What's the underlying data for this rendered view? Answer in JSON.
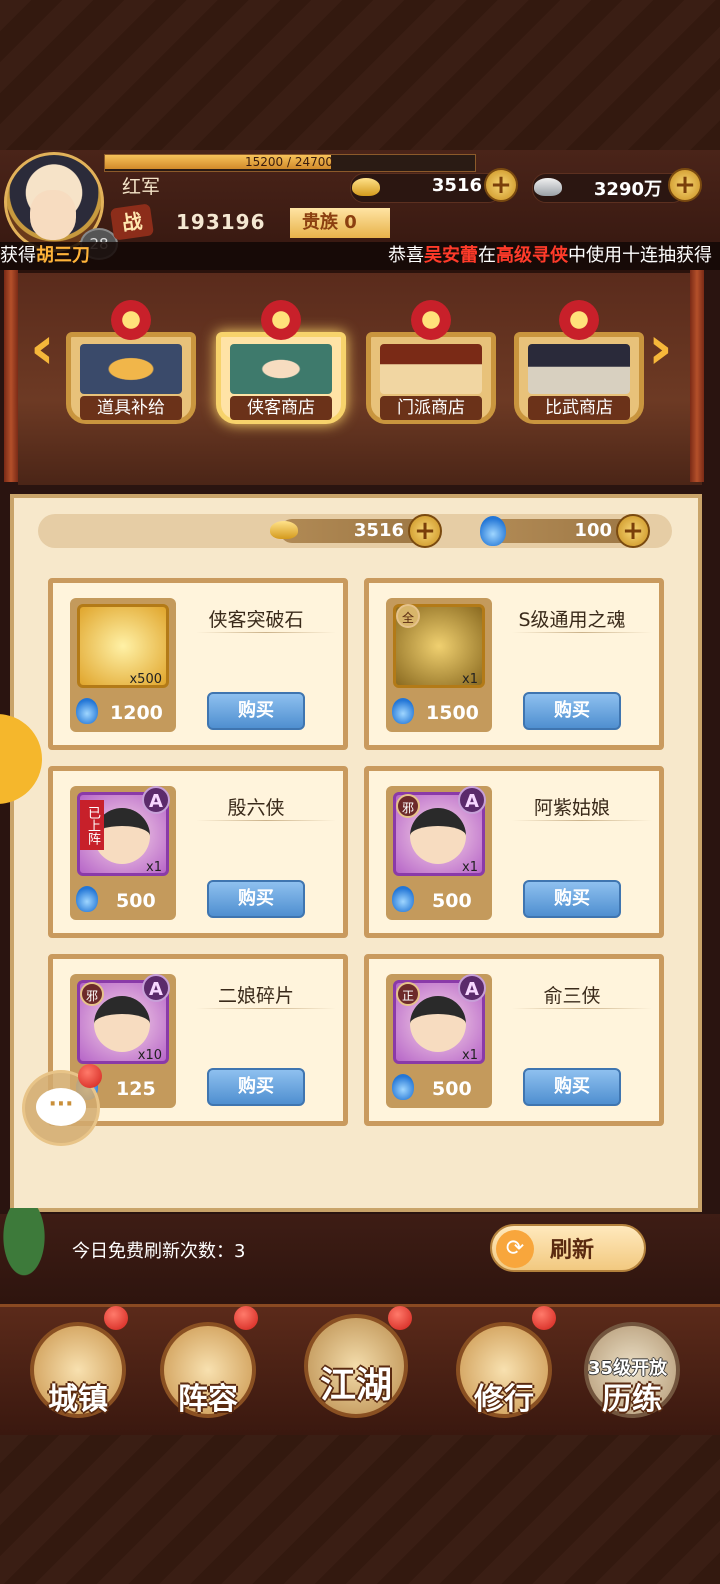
{
  "header": {
    "exp_text": "15200 / 24700",
    "exp_fraction": 0.615,
    "player_name": "红军",
    "level": "28",
    "gold": "3516",
    "silver": "3290万",
    "power_label": "战",
    "power_value": "193196",
    "noble_label": "贵族 0"
  },
  "marquee": {
    "left_prefix": "获得",
    "left_name": "胡三刀",
    "right_prefix": "恭喜",
    "right_name": "吴安蕾",
    "right_mid": "在",
    "right_event": "高级寻侠",
    "right_suffix": "中使用十连抽获得"
  },
  "tabs": [
    {
      "label": "道具补给",
      "active": false
    },
    {
      "label": "侠客商店",
      "active": true
    },
    {
      "label": "门派商店",
      "active": false
    },
    {
      "label": "比武商店",
      "active": false
    }
  ],
  "currency": {
    "gold": "3516",
    "spirit": "100"
  },
  "buy_label": "购买",
  "items": [
    {
      "name": "侠客突破石",
      "qty": "x500",
      "price": "1200",
      "frame": "gold"
    },
    {
      "name": "S级通用之魂",
      "qty": "x1",
      "price": "1500",
      "frame": "gold",
      "tag": "全"
    },
    {
      "name": "殷六侠",
      "qty": "x1",
      "price": "500",
      "frame": "purple",
      "grade": "A",
      "ribbon": "已上阵"
    },
    {
      "name": "阿紫姑娘",
      "qty": "x1",
      "price": "500",
      "frame": "purple",
      "grade": "A",
      "tag": "邪"
    },
    {
      "name": "二娘碎片",
      "qty": "x10",
      "price": "125",
      "frame": "purple",
      "grade": "A",
      "tag": "邪"
    },
    {
      "name": "俞三侠",
      "qty": "x1",
      "price": "500",
      "frame": "purple",
      "grade": "A",
      "tag": "正"
    }
  ],
  "refresh": {
    "free_text": "今日免费刷新次数：3",
    "button_label": "刷新"
  },
  "nav": [
    {
      "label": "城镇",
      "badge": true
    },
    {
      "label": "阵容",
      "badge": true
    },
    {
      "label": "江湖",
      "badge": true
    },
    {
      "label": "修行",
      "badge": true
    },
    {
      "label": "历练",
      "badge": false,
      "lock_text": "35级开放"
    }
  ],
  "colors": {
    "accent_gold": "#f7c25a",
    "buy_blue": "#4f8fd0",
    "highlight_red": "#ff3b2a",
    "highlight_orange": "#ffb43a"
  }
}
